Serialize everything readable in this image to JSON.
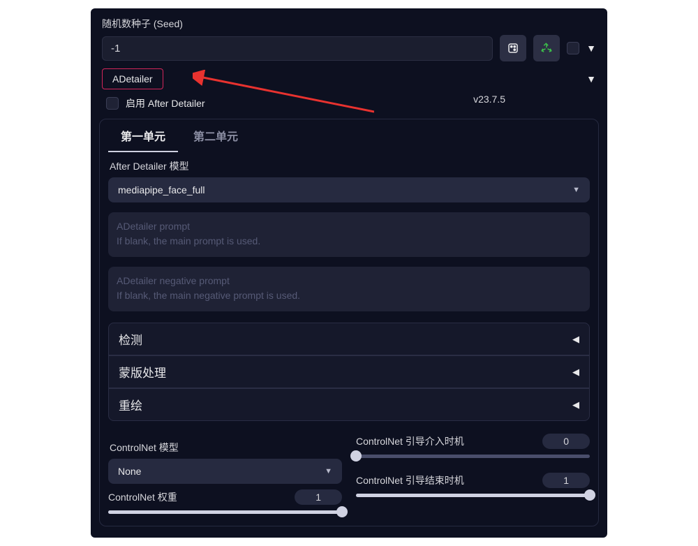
{
  "seed": {
    "label": "随机数种子 (Seed)",
    "value": "-1"
  },
  "adetailer": {
    "title": "ADetailer",
    "enable_label": "启用 After Detailer",
    "version": "v23.7.5",
    "tabs": {
      "unit1": "第一单元",
      "unit2": "第二单元"
    },
    "model": {
      "label": "After Detailer 模型",
      "value": "mediapipe_face_full"
    },
    "prompt": {
      "ph_line1": "ADetailer prompt",
      "ph_line2": "If blank, the main prompt is used."
    },
    "neg_prompt": {
      "ph_line1": "ADetailer negative prompt",
      "ph_line2": "If blank, the main negative prompt is used."
    },
    "acc": {
      "detect": "检测",
      "mask": "蒙版处理",
      "inpaint": "重绘"
    },
    "cn": {
      "model_label": "ControlNet 模型",
      "model_value": "None",
      "weight_label": "ControlNet 权重",
      "weight_value": "1",
      "start_label": "ControlNet 引导介入时机",
      "start_value": "0",
      "end_label": "ControlNet 引导结束时机",
      "end_value": "1"
    }
  }
}
